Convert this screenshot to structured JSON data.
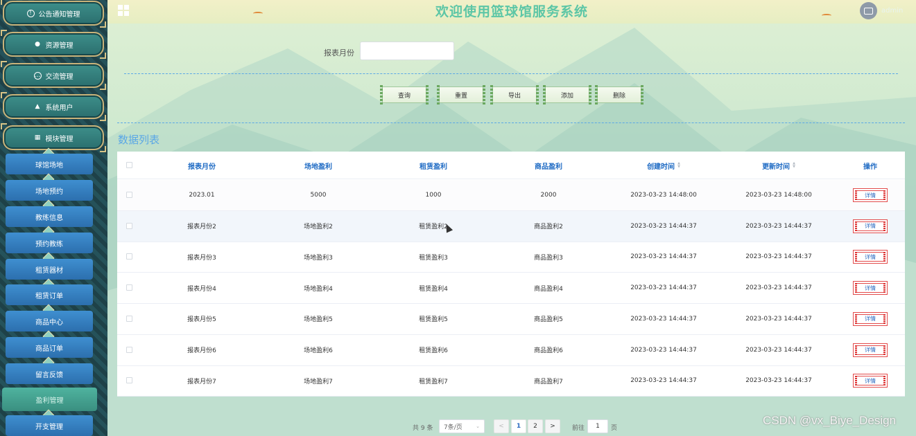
{
  "header": {
    "title": "欢迎使用篮球馆服务系统",
    "username": "admin"
  },
  "sidebar": {
    "groups": [
      {
        "label": "公告通知管理",
        "icon": "info-circle-icon"
      },
      {
        "label": "资源管理",
        "icon": "location-pin-icon"
      },
      {
        "label": "交流管理",
        "icon": "chat-bubble-icon"
      },
      {
        "label": "系统用户",
        "icon": "user-icon"
      },
      {
        "label": "模块管理",
        "icon": "grid-icon"
      }
    ],
    "items": [
      {
        "label": "球馆场地"
      },
      {
        "label": "场地预约"
      },
      {
        "label": "教练信息"
      },
      {
        "label": "预约教练"
      },
      {
        "label": "租赁器材"
      },
      {
        "label": "租赁订单"
      },
      {
        "label": "商品中心"
      },
      {
        "label": "商品订单"
      },
      {
        "label": "留言反馈"
      },
      {
        "label": "盈利管理",
        "active": true
      },
      {
        "label": "开支管理"
      }
    ]
  },
  "search": {
    "label": "报表月份",
    "value": "",
    "placeholder": ""
  },
  "toolbar": {
    "query": "查询",
    "reset": "重置",
    "export": "导出",
    "add": "添加",
    "delete": "删除"
  },
  "list_title": "数据列表",
  "table": {
    "columns": [
      "报表月份",
      "场地盈利",
      "租赁盈利",
      "商品盈利",
      "创建时间",
      "更新时间",
      "操作"
    ],
    "rows": [
      {
        "month": "2023.01",
        "venue": "5000",
        "rental": "1000",
        "goods": "2000",
        "created": "2023-03-23 14:48:00",
        "updated": "2023-03-23 14:48:00",
        "action": "详情"
      },
      {
        "month": "报表月份2",
        "venue": "场地盈利2",
        "rental": "租赁盈利2",
        "goods": "商品盈利2",
        "created": "2023-03-23 14:44:37",
        "updated": "2023-03-23 14:44:37",
        "action": "详情"
      },
      {
        "month": "报表月份3",
        "venue": "场地盈利3",
        "rental": "租赁盈利3",
        "goods": "商品盈利3",
        "created": "2023-03-23 14:44:37",
        "updated": "2023-03-23 14:44:37",
        "action": "详情"
      },
      {
        "month": "报表月份4",
        "venue": "场地盈利4",
        "rental": "租赁盈利4",
        "goods": "商品盈利4",
        "created": "2023-03-23 14:44:37",
        "updated": "2023-03-23 14:44:37",
        "action": "详情"
      },
      {
        "month": "报表月份5",
        "venue": "场地盈利5",
        "rental": "租赁盈利5",
        "goods": "商品盈利5",
        "created": "2023-03-23 14:44:37",
        "updated": "2023-03-23 14:44:37",
        "action": "详情"
      },
      {
        "month": "报表月份6",
        "venue": "场地盈利6",
        "rental": "租赁盈利6",
        "goods": "商品盈利6",
        "created": "2023-03-23 14:44:37",
        "updated": "2023-03-23 14:44:37",
        "action": "详情"
      },
      {
        "month": "报表月份7",
        "venue": "场地盈利7",
        "rental": "租赁盈利7",
        "goods": "商品盈利7",
        "created": "2023-03-23 14:44:37",
        "updated": "2023-03-23 14:44:37",
        "action": "详情"
      }
    ]
  },
  "pagination": {
    "total": "共 9 条",
    "page_size": "7条/页",
    "prev": "<",
    "pages": [
      "1",
      "2"
    ],
    "current_page": "1",
    "next": ">",
    "jump_label": "前往",
    "jump_value": "1",
    "jump_unit": "页"
  },
  "watermark": "CSDN @vx_Biye_Design",
  "colors": {
    "title": "#5cc6a6",
    "accent": "#5aa7e6",
    "header_text": "#1f6bc4",
    "detail_border": "#e24a4a"
  }
}
